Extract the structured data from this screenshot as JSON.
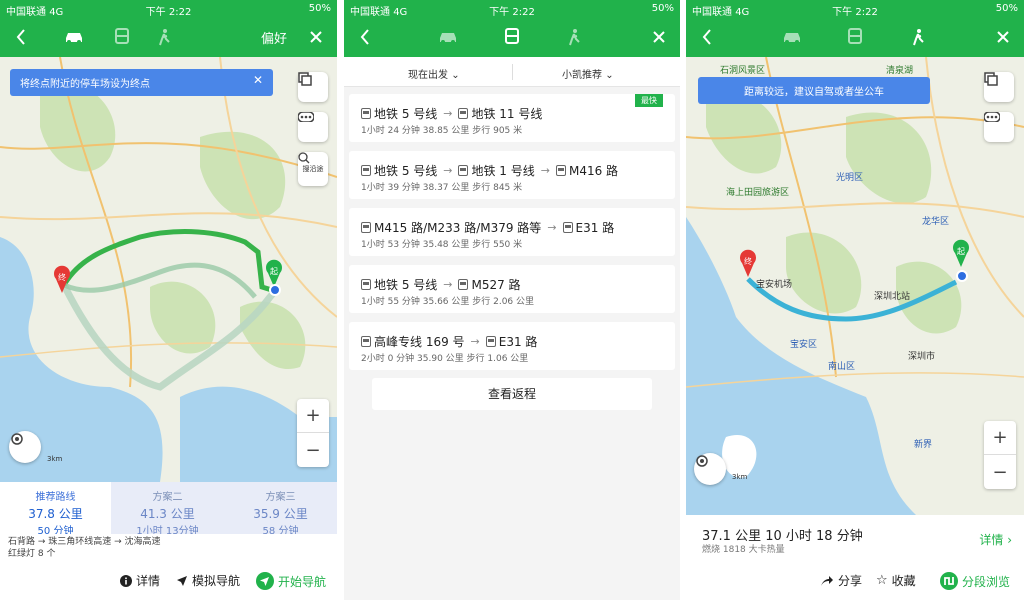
{
  "status": {
    "carrier": "中国联通",
    "network": "4G",
    "time": "下午 2:22",
    "battery": "50%"
  },
  "panel1": {
    "preference": "偏好",
    "tip": "将终点附近的停车场设为终点",
    "search_along": "搜沿途",
    "scale": "3km",
    "plans": [
      {
        "title": "推荐路线",
        "distance": "37.8 公里",
        "time": "50 分钟"
      },
      {
        "title": "方案二",
        "distance": "41.3 公里",
        "time": "1小时 13分钟"
      },
      {
        "title": "方案三",
        "distance": "35.9 公里",
        "time": "58 分钟"
      }
    ],
    "roads": "石背路 → 珠三角环线高速 → 沈海高速",
    "lights": "红绿灯 8 个",
    "actions": {
      "detail": "详情",
      "simulate": "模拟导航",
      "start": "开始导航"
    },
    "end_label": "终",
    "start_label": "起"
  },
  "panel2": {
    "filter_time": "现在出发",
    "filter_pref": "小凯推荐",
    "fastest": "最快",
    "routes": [
      {
        "segments": [
          {
            "type": "metro",
            "name": "地铁 5 号线"
          },
          {
            "type": "metro",
            "name": "地铁 11 号线"
          }
        ],
        "meta": "1小时 24 分钟   38.85 公里   步行 905 米"
      },
      {
        "segments": [
          {
            "type": "metro",
            "name": "地铁 5 号线"
          },
          {
            "type": "metro",
            "name": "地铁 1 号线"
          },
          {
            "type": "bus",
            "name": "M416 路"
          }
        ],
        "meta": "1小时 39 分钟   38.37 公里   步行 845 米"
      },
      {
        "segments": [
          {
            "type": "bus",
            "name": "M415 路/M233 路/M379 路等"
          },
          {
            "type": "bus",
            "name": "E31 路"
          }
        ],
        "meta": "1小时 53 分钟   35.48 公里   步行 550 米"
      },
      {
        "segments": [
          {
            "type": "metro",
            "name": "地铁 5 号线"
          },
          {
            "type": "bus",
            "name": "M527 路"
          }
        ],
        "meta": "1小时 55 分钟   35.66 公里   步行 2.06 公里"
      },
      {
        "segments": [
          {
            "type": "bus",
            "name": "高峰专线 169 号"
          },
          {
            "type": "bus",
            "name": "E31 路"
          }
        ],
        "meta": "2小时 0 分钟   35.90 公里   步行 1.06 公里"
      }
    ],
    "return_button": "查看返程"
  },
  "panel3": {
    "tip": "距离较远，建议自驾或者坐公车",
    "places": [
      "石洞风景区",
      "清泉湖",
      "光明区",
      "海上田园旅游区",
      "龙华区",
      "宝安机场",
      "深圳北站",
      "宝安区",
      "深圳市",
      "南山区",
      "新界"
    ],
    "summary": "37.1 公里  10 小时 18 分钟",
    "calories": "燃烧 1818 大卡热量",
    "detail": "详情",
    "actions": {
      "share": "分享",
      "favorite": "收藏",
      "segment": "分段浏览"
    },
    "scale": "3km",
    "end_label": "终",
    "start_label": "起"
  }
}
